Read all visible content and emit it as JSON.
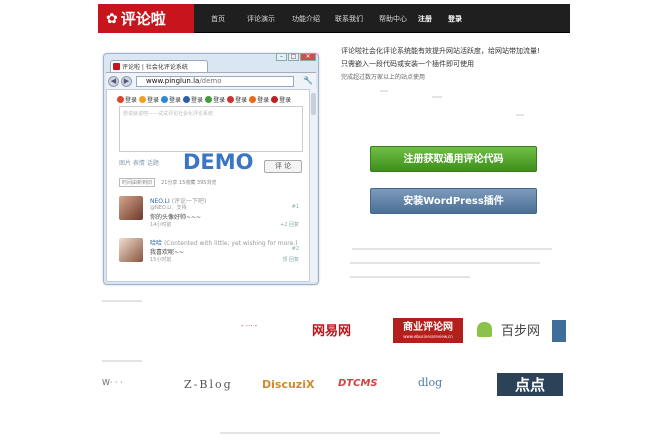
{
  "header": {
    "logo_text": "评论啦",
    "nav": [
      "首页",
      "评论演示",
      "功能介绍",
      "联系我们",
      "帮助中心",
      "注册",
      "登录"
    ]
  },
  "browser": {
    "tab_title": "评论啦 | 社会化评论系统",
    "url_host": "www.pinglun.la",
    "url_path": "/demo",
    "logins": [
      "登录",
      "登录",
      "登录",
      "登录",
      "登录",
      "登录",
      "登录",
      "登录"
    ],
    "editor_placeholder": "想说就说吧——试试评论社会化评论系统",
    "tools": "图片 表情 话题",
    "demo_label": "DEMO",
    "submit_label": "评 论",
    "sort_label": "时间由新到旧",
    "stats": "21分享 15收藏 395浏览",
    "comments": [
      {
        "name": "NEO.LI",
        "aside": "(评论一下吧)",
        "quote": "@NEO.LI：支持",
        "text": "你的头像好帅~~~",
        "time": "14小时前",
        "right": "#1",
        "right2": "+2  回复"
      },
      {
        "name": "哈哈",
        "aside": "(Contented with little, yet wishing for more.)",
        "quote": "",
        "text": "我喜欢呢~~",
        "time": "15小时前",
        "right": "#2",
        "right2": "顶  回复"
      }
    ]
  },
  "intro": {
    "line1": "评论啦社会化评论系统能有效提升网站活跃度，给网站带加流量!",
    "line2": "只需嵌入一段代码或安装一个插件即可使用",
    "line3": "完成超过数万家以上的站点使用"
  },
  "buttons": {
    "register": "注册获取通用评论代码",
    "wordpress": "安装WordPress插件"
  },
  "partners": {
    "wangyi": "网易网",
    "shangye": "商业评论网",
    "shangye_small": "www.ebusinessreview.cn",
    "diandian": "点点",
    "discuz": "DiscuziX",
    "zblog": "Z-Blog",
    "dtcms": "DTCMS",
    "dxlog": "dlog",
    "xiang": "百步网"
  },
  "colors": {
    "brand_red": "#c8151d",
    "nav_bg": "#1f1f1f",
    "green_button": "#4ea32b",
    "blue_button": "#5b7ea3"
  }
}
